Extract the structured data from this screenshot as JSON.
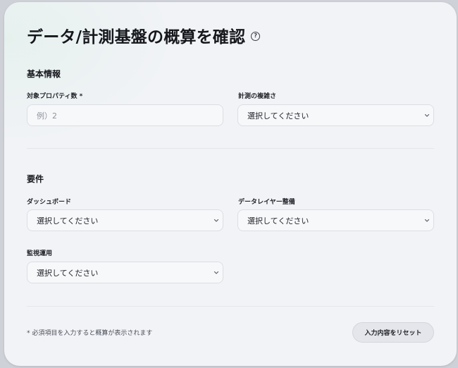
{
  "header": {
    "title": "データ/計測基盤の概算を確認",
    "help_icon": "question-circle-icon"
  },
  "basic_section": {
    "title": "基本情報",
    "properties": {
      "label": "対象プロパティ数 *",
      "placeholder": "例）2"
    },
    "complexity": {
      "label": "計測の複雑さ",
      "value": "選択してください"
    }
  },
  "requirements_section": {
    "title": "要件",
    "dashboard": {
      "label": "ダッシュボード",
      "value": "選択してください"
    },
    "data_layer": {
      "label": "データレイヤー整備",
      "value": "選択してください"
    },
    "monitoring": {
      "label": "監視運用",
      "value": "選択してください"
    }
  },
  "footer": {
    "note": "* 必須項目を入力すると概算が表示されます",
    "reset_label": "入力内容をリセット"
  }
}
